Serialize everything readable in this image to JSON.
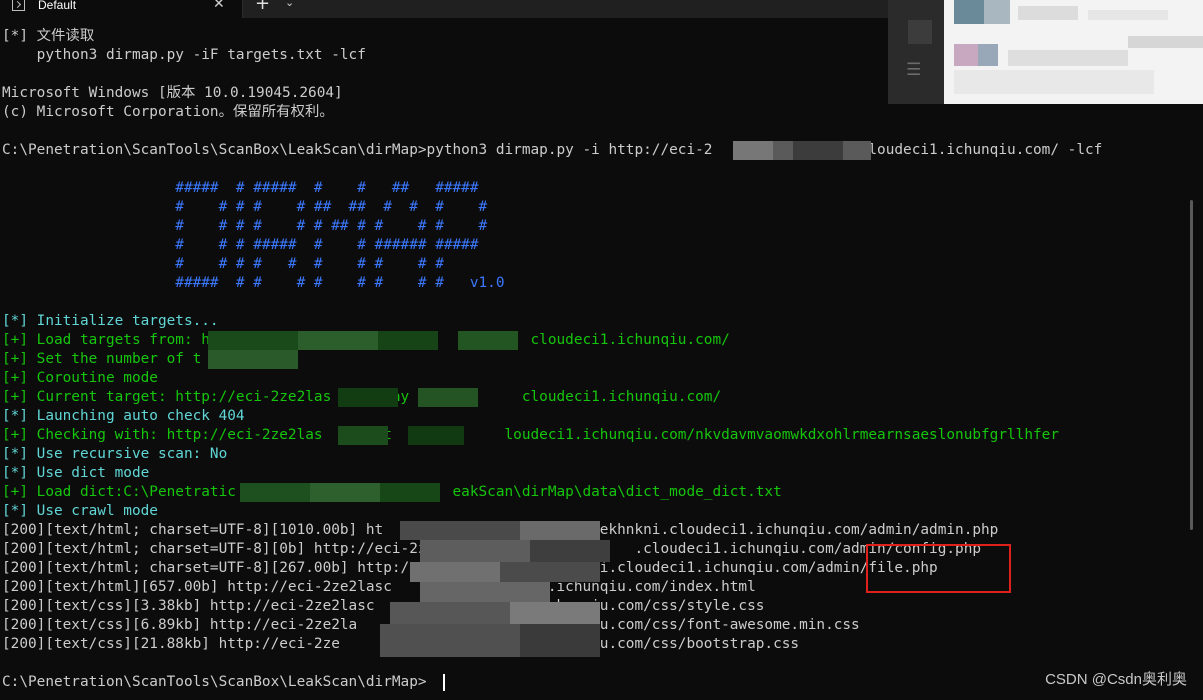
{
  "tab": {
    "title": "Default",
    "close_glyph": "✕",
    "new_tab_glyph": "+",
    "dropdown_glyph": "⌄"
  },
  "side_window": {
    "menu_glyph": "☰"
  },
  "colors": {
    "background": "#0c0c0c",
    "default_text": "#cccccc",
    "info_text": "#61d6d6",
    "success_text": "#16c60c",
    "banner_text": "#3b78ff",
    "highlight_box": "#e0201a"
  },
  "terminal": {
    "lines": [
      "[*] 文件读取",
      "    python3 dirmap.py -iF targets.txt -lcf",
      "",
      "Microsoft Windows [版本 10.0.19045.2604]",
      "(c) Microsoft Corporation。保留所有权利。",
      "",
      "C:\\Penetration\\ScanTools\\ScanBox\\LeakScan\\dirMap>python3 dirmap.py -i http://eci-2             kni.cloudeci1.ichunqiu.com/ -lcf",
      "",
      "                    #####  # #####  #    #   ##   #####",
      "                    #    # # #    # ##  ##  #  #  #    #",
      "                    #    # # #    # # ## # #    # #    #",
      "                    #    # # #####  #    # ###### #####",
      "                    #    # # #   #  #    # #    # #",
      "                    #####  # #    # #    # #    # #   v1.0",
      "",
      "[*] Initialize targets...",
      "[+] Load targets from: h                         y   hun     cloudeci1.ichunqiu.com/",
      "[+] Set the number of t",
      "[+] Coroutine mode",
      "[+] Current target: http://eci-2ze2las       ay             cloudeci1.ichunqiu.com/",
      "[*] Launching auto check 404",
      "[+] Checking with: http://eci-2ze2las       t             loudeci1.ichunqiu.com/nkvdavmvaomwkdxohlrmearnsaeslonubfgrllhfer",
      "[*] Use recursive scan: No",
      "[*] Use dict mode",
      "[+] Load dict:C:\\Penetratic                         eakScan\\dirMap\\data\\dict_mode_dict.txt",
      "[*] Use crawl mode",
      "[200][text/html; charset=UTF-8][1010.00b] ht                       ytekhnkni.cloudeci1.ichunqiu.com/admin/admin.php",
      "[200][text/html; charset=UTF-8][0b] http://eci-2z        q4              .cloudeci1.ichunqiu.com/admin/config.php",
      "[200][text/html; charset=UTF-8][267.00b] http:/                ekhnkni.cloudeci1.ichunqiu.com/admin/file.php",
      "[200][text/html][657.00b] http://eci-2ze2lasc                 1.ichunqiu.com/index.html",
      "[200][text/css][3.38kb] http://eci-2ze2lasc                   ichunqiu.com/css/style.css",
      "[200][text/css][6.89kb] http://eci-2ze2la                     ichunqiu.com/css/font-awesome.min.css",
      "[200][text/css][21.88kb] http://eci-2ze                      .ichunqiu.com/css/bootstrap.css",
      "",
      "C:\\Penetration\\ScanTools\\ScanBox\\LeakScan\\dirMap>"
    ]
  },
  "watermark": "CSDN @Csdn奥利奥"
}
